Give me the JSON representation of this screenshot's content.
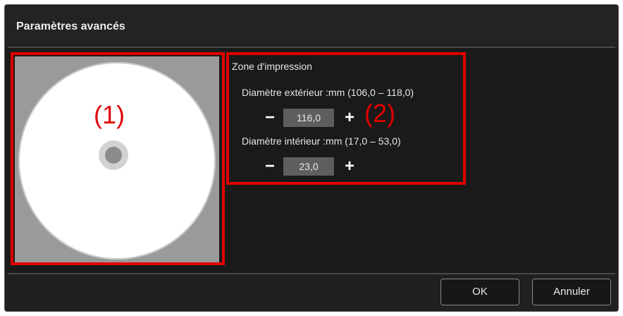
{
  "dialog": {
    "title": "Paramètres avancés"
  },
  "preview": {
    "callout": "(1)"
  },
  "settings": {
    "zone_label": "Zone d'impression",
    "callout": "(2)",
    "outer": {
      "label": "Diamètre extérieur :mm (106,0 – 118,0)",
      "value": "116,0",
      "minus": "−",
      "plus": "+"
    },
    "inner": {
      "label": "Diamètre intérieur :mm (17,0 – 53,0)",
      "value": "23,0",
      "minus": "−",
      "plus": "+"
    }
  },
  "footer": {
    "ok_label": "OK",
    "cancel_label": "Annuler"
  },
  "colors": {
    "callout_red": "#e00000",
    "dialog_bg": "#1d1d1d",
    "field_bg": "#5e5e5e",
    "preview_bg": "#9a9a9a"
  }
}
